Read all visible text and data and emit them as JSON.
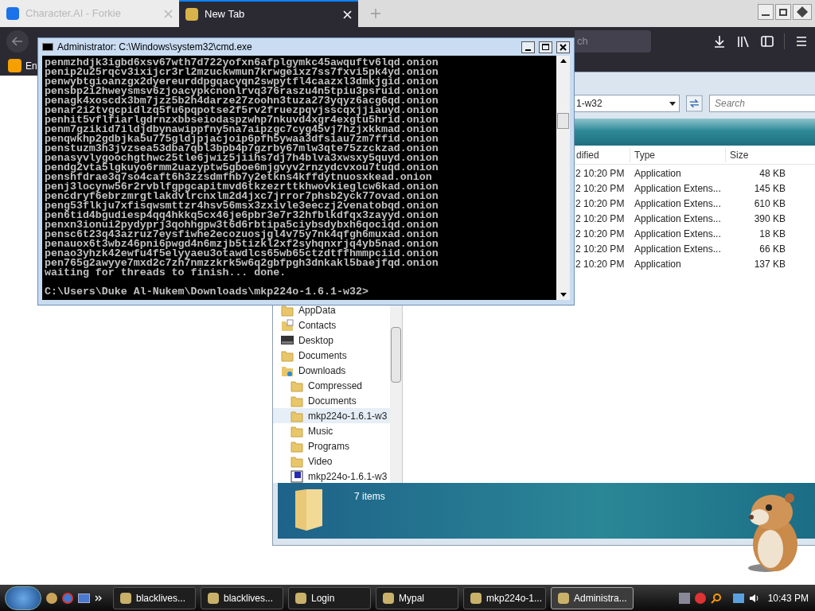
{
  "browser": {
    "tabs": [
      {
        "label": "Character.AI - Forkie",
        "selected": false
      },
      {
        "label": "New Tab",
        "selected": true
      }
    ],
    "search_text": "ch",
    "bookmark": "En"
  },
  "cmd": {
    "title": "Administrator: C:\\Windows\\system32\\cmd.exe",
    "lines": [
      "penmzhdjk3igbd6xsv67wth7d722yofxn6afplgymkc45awquftv6lqd.onion",
      "penip2u25rqcv3ixijcr3rl2mzuckwmun7krwgeixz7ss7fxvi5pk4yd.onion",
      "penwybtgioanzgx2dyereurddpgqacyqn2swpytfl4caazxl3dmkjgid.onion",
      "pensbp2i2hweysmsv6zjoacypkcnonlrvq376raszu4n5tpiu3psruid.onion",
      "penagk4xoscdx3bm7jzz5b2h4darze27zoohn3tuza273yqyz6acg6qd.onion",
      "penar2i2tvgcpidlzq5fu6pqpotse2f5rv2fruezpqvjsscqxjjiauyd.onion",
      "penhit5vflfiarlgdrnzxbbseiodaspzwhp7nkuvd4xgr4exgtu5hrid.onion",
      "penm7gzikid7ildjdbynawippfny5na7aipzgc7cyg45vj7hzjxkkmad.onion",
      "penqwkhp2gdbjka5u775gldjpjacjoip6pfh5ywaa3dfsiau7zm7ffid.onion",
      "penstuzm3h3jvzsea53dba7qbl3bpb4p7gzrby67mlw3qte75zzckzad.onion",
      "penasyvlygoochgthwc25tle6jwiz5jiihs7dj7h4blva3xwsxy5quyd.onion",
      "pendg2vta5lgkuyo6rmm2uazyptw5gboe6mjgvyv2rnzydcvxou7tuqd.onion",
      "penshfdrae3q7so4caft6h3zzsdmfhb7y2etkns4kffdytnuosxkead.onion",
      "penj3locynw56r2rvblfgpgcapitmvd6tkzezrttkhwovkieglcw6kad.onion",
      "pencdryf6ebrzmrgtlakdvlrcnxlm2d4jxc7jrror7phsb2yck77ovad.onion",
      "peng53flkju7xfisqwsmttzr4hsv56msx3zxivle3eeczj2venatobqd.onion",
      "pen6tid4bgudiesp4qq4hkkq5cx46je6pbr3e7r32hfblkdfqx3zayyd.onion",
      "penxn3ionui2pydyprj3qohhgpw3t6d6rbtipa5ciybsdybxh6qociqd.onion",
      "pensc6t23q43azruz7eysfiwhe2ecozuosjgl4v75y7nk4qfgh6muxad.onion",
      "penauox6t3wbz46pni6pwgd4n6mzjb5tizkl2xf2syhqnxrjq4yb5nad.onion",
      "penao3yhzk42ewfu4f5elyyaeu3otawdlcs65wb65ctzdtffhmmpciid.onion",
      "pen765g2awyye7mxd2c7zh7nmzzkrk5w6q2gbfpgh3dnkakl5baejfqd.onion",
      "waiting for threads to finish... done."
    ],
    "prompt": "C:\\Users\\Duke Al-Nukem\\Downloads\\mkp224o-1.6.1-w32>"
  },
  "explorer": {
    "address": "1-w32",
    "search_placeholder": "Search",
    "columns": [
      "dified",
      "Type",
      "Size"
    ],
    "rows": [
      {
        "date": "2 10:20 PM",
        "type": "Application",
        "size": "48 KB"
      },
      {
        "date": "2 10:20 PM",
        "type": "Application Extens...",
        "size": "145 KB"
      },
      {
        "date": "2 10:20 PM",
        "type": "Application Extens...",
        "size": "610 KB"
      },
      {
        "date": "2 10:20 PM",
        "type": "Application Extens...",
        "size": "390 KB"
      },
      {
        "date": "2 10:20 PM",
        "type": "Application Extens...",
        "size": "18 KB"
      },
      {
        "date": "2 10:20 PM",
        "type": "Application Extens...",
        "size": "66 KB"
      },
      {
        "date": "2 10:20 PM",
        "type": "Application",
        "size": "137 KB"
      }
    ],
    "tree": [
      {
        "label": "AppData",
        "kind": "folder",
        "selected": false
      },
      {
        "label": "Contacts",
        "kind": "contacts",
        "selected": false
      },
      {
        "label": "Desktop",
        "kind": "desktop",
        "selected": false
      },
      {
        "label": "Documents",
        "kind": "folder",
        "selected": false
      },
      {
        "label": "Downloads",
        "kind": "downloads",
        "selected": false,
        "children": [
          {
            "label": "Compressed",
            "kind": "folder",
            "selected": false
          },
          {
            "label": "Documents",
            "kind": "folder",
            "selected": false
          },
          {
            "label": "mkp224o-1.6.1-w3",
            "kind": "folder",
            "selected": true
          },
          {
            "label": "Music",
            "kind": "folder",
            "selected": false
          },
          {
            "label": "Programs",
            "kind": "folder",
            "selected": false
          },
          {
            "label": "Video",
            "kind": "folder",
            "selected": false
          },
          {
            "label": "mkp224o-1.6.1-w3",
            "kind": "archive",
            "selected": false
          }
        ]
      }
    ],
    "status": "7 items"
  },
  "taskbar": {
    "buttons": [
      {
        "label": "blacklives...",
        "selected": false
      },
      {
        "label": "blacklives...",
        "selected": false
      },
      {
        "label": "Login",
        "selected": false
      },
      {
        "label": "Mypal",
        "selected": false
      },
      {
        "label": "mkp224o-1...",
        "selected": false
      },
      {
        "label": "Administra...",
        "selected": true
      }
    ],
    "clock": "10:43 PM"
  }
}
